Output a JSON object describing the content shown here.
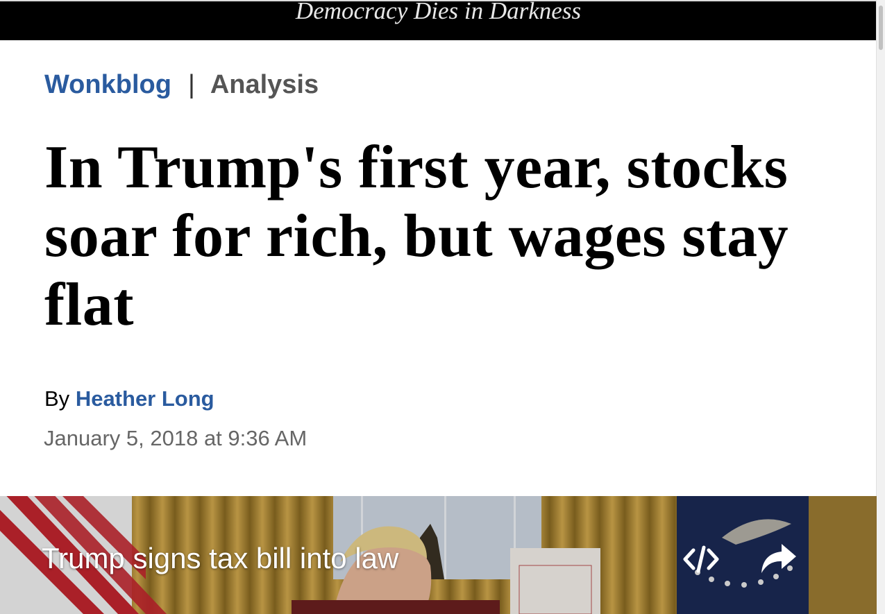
{
  "masthead": {
    "tagline": "Democracy Dies in Darkness"
  },
  "kicker": {
    "section": "Wonkblog",
    "separator": "|",
    "label": "Analysis"
  },
  "headline": "In Trump's first year, stocks soar for rich, but wages stay flat",
  "byline": {
    "prefix": "By",
    "author": "Heather Long"
  },
  "dateline": "January 5, 2018 at 9:36 AM",
  "video": {
    "caption": "Trump signs tax bill into law",
    "embed_icon": "embed-code-icon",
    "share_icon": "share-arrow-icon"
  },
  "colors": {
    "link_blue": "#2a5b9f",
    "masthead_bg": "#000000",
    "kicker_gray": "#555555"
  }
}
